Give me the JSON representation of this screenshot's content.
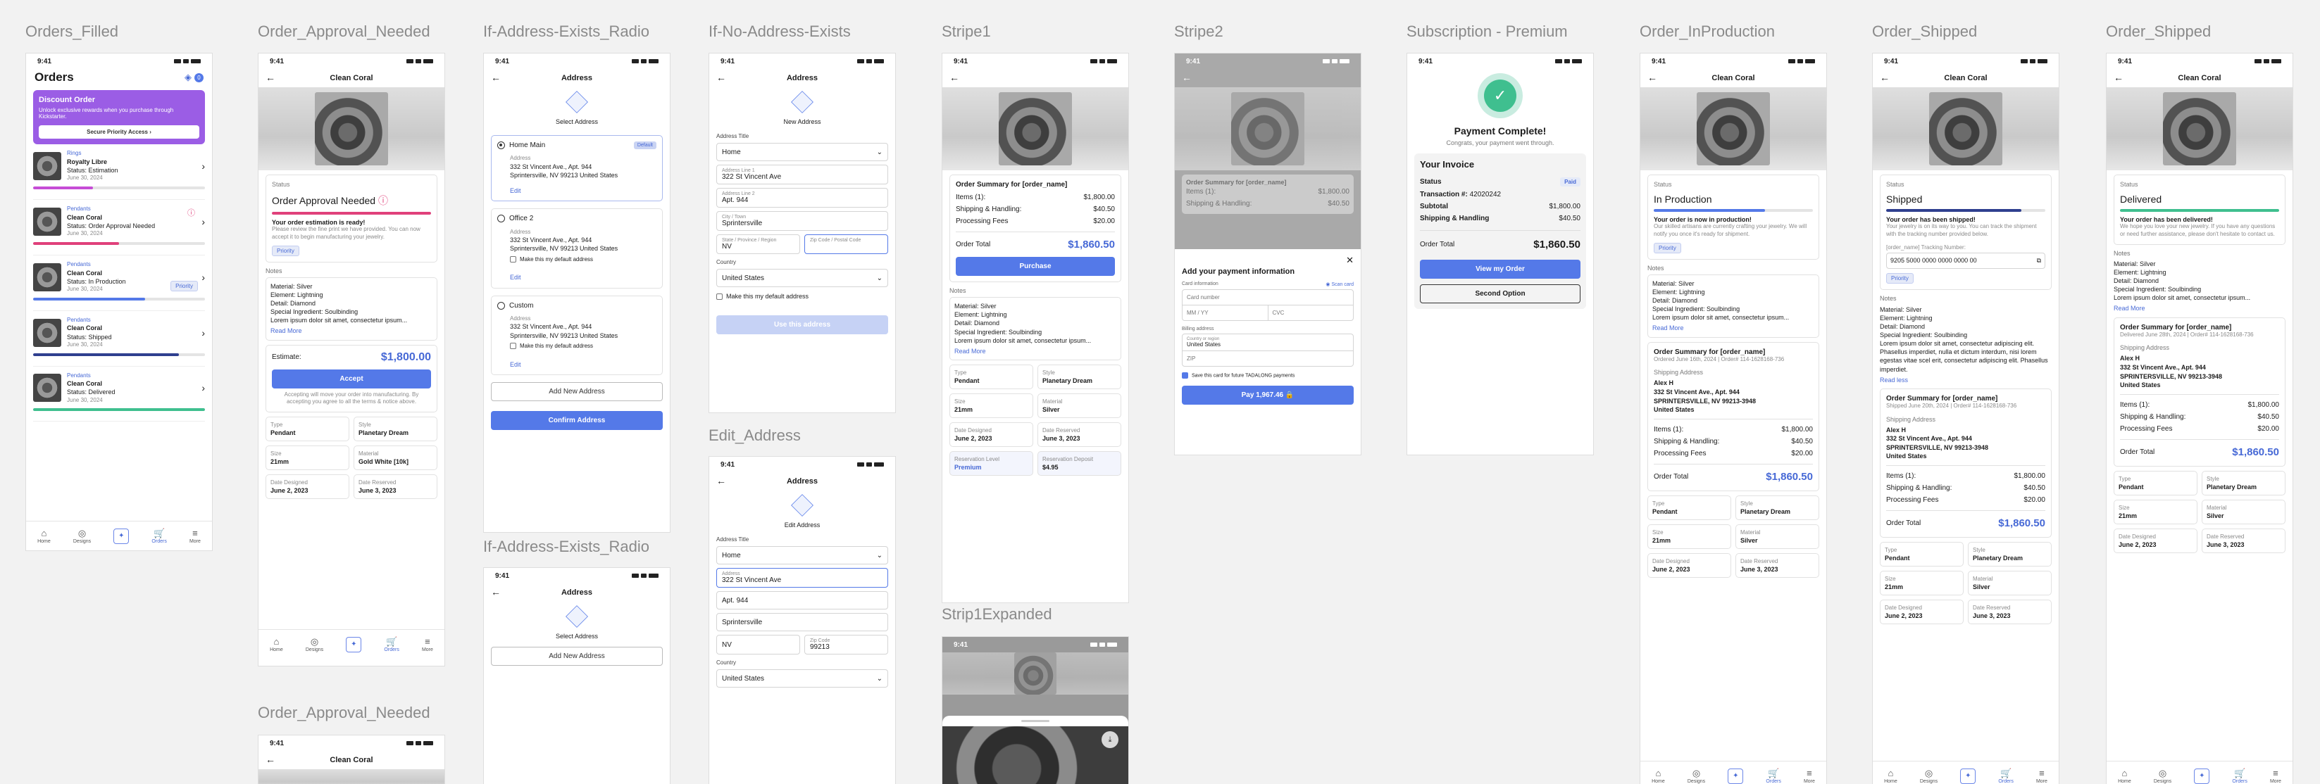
{
  "labels": {
    "orders_filled": "Orders_Filled",
    "approval": "Order_Approval_Needed",
    "radio1": "If-Address-Exists_Radio",
    "noaddr": "If-No-Address-Exists",
    "stripe1": "Stripe1",
    "stripe2": "Stripe2",
    "sub": "Subscription - Premium",
    "inprod": "Order_InProduction",
    "shipped": "Order_Shipped",
    "delivered": "Order_Shipped",
    "edit": "Edit_Address",
    "strip1exp": "Strip1Expanded",
    "radio2": "If-Address-Exists_Radio",
    "approval2": "Order_Approval_Needed"
  },
  "common": {
    "time": "9:41",
    "product": "Clean Coral",
    "back": "←",
    "status": "Status",
    "notes": "Notes",
    "material": "Material: Silver",
    "element": "Element: Lightning",
    "detail": "Detail: Diamond",
    "special": "Special Ingredient: Soulbinding",
    "lorem": "Lorem ipsum dolor sit amet, consectetur ipsum...",
    "read_more": "Read More",
    "priority": "Priority",
    "type_k": "Type",
    "type_v": "Pendant",
    "style_k": "Style",
    "style_v": "Planetary Dream",
    "size_k": "Size",
    "size_v": "21mm",
    "mat_k": "Material",
    "mat_v": "Silver",
    "date_d_k": "Date Designed",
    "date_d_v": "June 2, 2023",
    "date_r_k": "Date Reserved",
    "date_r_v": "June 3, 2023",
    "address_title": "Address",
    "summary": "Order Summary for [order_name]",
    "items": "Items (1):",
    "shipping": "Shipping & Handling:",
    "processing": "Processing Fees",
    "order_total": "Order Total",
    "v_items": "$1,800.00",
    "v_ship": "$40.50",
    "v_proc": "$20.00",
    "v_total": "$1,860.50",
    "ship_addr": "Shipping Address",
    "ship_name": "Alex H",
    "ship_l1": "332 St Vincent Ave., Apt. 944",
    "ship_l2": "SPRINTERSVILLE, NV 99213-3948",
    "ship_l3": "United States",
    "mat_gold": "Gold White [10k]"
  },
  "nav": {
    "home": "Home",
    "designs": "Designs",
    "orders": "Orders",
    "more": "More"
  },
  "orders": {
    "title": "Orders",
    "badge": "0",
    "promo_title": "Discount Order",
    "promo_text": "Unlock exclusive rewards when you purchase through Kickstarter.",
    "promo_btn": "Secure Priority Access  ›",
    "items": [
      {
        "cat": "Rings",
        "name": "Royalty Libre",
        "status": "Status: Estimation",
        "date": "June 30, 2024",
        "color": "#c64cd6",
        "fill": "35%"
      },
      {
        "cat": "Pendants",
        "name": "Clean Coral",
        "status": "Status: Order Approval Needed",
        "date": "June 30, 2024",
        "color": "#e0417b",
        "fill": "50%"
      },
      {
        "cat": "Pendants",
        "name": "Clean Coral",
        "status": "Status: In Production",
        "date": "June 30, 2024",
        "color": "#5479e8",
        "fill": "65%"
      },
      {
        "cat": "Pendants",
        "name": "Clean Coral",
        "status": "Status: Shipped",
        "date": "June 30, 2024",
        "color": "#2f3f8f",
        "fill": "85%"
      },
      {
        "cat": "Pendants",
        "name": "Clean Coral",
        "status": "Status: Delivered",
        "date": "June 30, 2024",
        "color": "#3fbf8f",
        "fill": "100%"
      }
    ]
  },
  "approval": {
    "heading": "Order Approval Needed",
    "msg_t": "Your order estimation is ready!",
    "msg": "Please review the fine print we have provided. You can now accept it to begin manufacturing your jewelry.",
    "est": "Estimate:",
    "est_v": "$1,800.00",
    "accept": "Accept",
    "fine": "Accepting will move your order into manufacturing. By accepting you agree to all the terms & notice above."
  },
  "radio": {
    "select": "Select Address",
    "opts": [
      {
        "t": "Home Main",
        "def": "Default",
        "l1": "332 St Vincent Ave., Apt. 944",
        "l2": "Sprintersville, NV 99213 United States",
        "edit": "Edit"
      },
      {
        "t": "Office 2",
        "l1": "332 St Vincent Ave., Apt. 944",
        "l2": "Sprintersville, NV 99213 United States",
        "mk": "Make this my default address",
        "edit": "Edit"
      },
      {
        "t": "Custom",
        "l1": "332 St Vincent Ave., Apt. 944",
        "l2": "Sprintersville, NV 99213 United States",
        "mk": "Make this my default address",
        "edit": "Edit"
      }
    ],
    "add": "Add New Address",
    "confirm": "Confirm Address",
    "addr_k": "Address"
  },
  "noaddr": {
    "new": "New Address",
    "addr_title": "Address Title",
    "addr_title_v": "Home",
    "l1_k": "Address Line 1",
    "l1_v": "322 St Vincent Ave",
    "l2_k": "Address Line 2",
    "l2_v": "Apt. 944",
    "city_k": "City / Town",
    "city_v": "Sprintersville",
    "state_k": "State / Province / Region",
    "state_v": "NV",
    "zip_k": "Zip Code / Postal Code",
    "country": "Country",
    "country_v": "United States",
    "mk": "Make this my default address",
    "use": "Use this address"
  },
  "edit": {
    "t": "Edit Address",
    "title_v": "Home",
    "l1_k": "Address",
    "l1_v": "322 St Vincent Ave",
    "l2_v": "Apt. 944",
    "city_v": "Sprintersville",
    "state_v": "NV",
    "zip_k": "Zip Code",
    "zip_v": "99213",
    "country": "Country",
    "country_v": "United States",
    "addr_title": "Address Title"
  },
  "stripe1": {
    "purchase": "Purchase",
    "type_k": "Type",
    "type_v": "Pendant",
    "style_k": "Style",
    "style_v": "Planetary Dream",
    "res_level": "Reservation Level",
    "res_level_v": "Premium",
    "res_dep": "Reservation Deposit",
    "res_dep_v": "$4.95"
  },
  "stripe2": {
    "h": "Add your payment information",
    "scan": "Scan card",
    "card_info": "Card information",
    "card_num": "Card number",
    "mmyy": "MM / YY",
    "cvc": "CVC",
    "billing": "Billing address",
    "country_k": "Country or region",
    "country_v": "United States",
    "zip": "ZIP",
    "save": "Save this card for future TADALONG payments",
    "pay": "Pay 1,967.46"
  },
  "sub": {
    "h": "Payment Complete!",
    "sub": "Congrats, your payment went through.",
    "inv": "Your Invoice",
    "status_k": "Status",
    "paid": "Paid",
    "trans": "Transaction #:",
    "trans_v": "42020242",
    "subtotal": "Subtotal",
    "subtotal_v": "$1,800.00",
    "ship": "Shipping & Handling",
    "ship_v": "$40.50",
    "total": "Order Total",
    "total_v": "$1,860.50",
    "view": "View my Order",
    "second": "Second Option"
  },
  "inprod": {
    "heading": "In Production",
    "msg_t": "Your order is now in production!",
    "msg": "Our skilled artisans are currently crafting your jewelry. We will notify you once it's ready for shipment.",
    "ordered": "Ordered June 16th, 2024 | Order# 114-1628168-736"
  },
  "shipped": {
    "heading": "Shipped",
    "msg_t": "Your order has been shipped!",
    "msg": "Your jewelry is on its way to you. You can track the shipment with the tracking number provided below.",
    "track_k": "[order_name] Tracking Number:",
    "track_v": "9205 5000 0000 0000 0000 00",
    "mat_long": "Lorem ipsum dolor sit amet, consectetur adipiscing elit. Phasellus imperdiet, nulla et dictum interdum, nisi lorem egestas vitae scel erit, consectetur adipiscing elit. Phasellus imperdiet.",
    "read_less": "Read less",
    "ordered": "Shipped June 20th, 2024 | Order# 114-1628168-736"
  },
  "delivered": {
    "heading": "Delivered",
    "msg_t": "Your order has been delivered!",
    "msg": "We hope you love your new jewelry. If you have any questions or need further assistance, please don't hesitate to contact us.",
    "ordered": "Delivered June 28th, 2024 | Order# 114-1628168-736"
  },
  "colors": {
    "accent": "#5479e8",
    "pink": "#e0417b",
    "green": "#3fbf8f",
    "purple": "#9b5de5"
  }
}
